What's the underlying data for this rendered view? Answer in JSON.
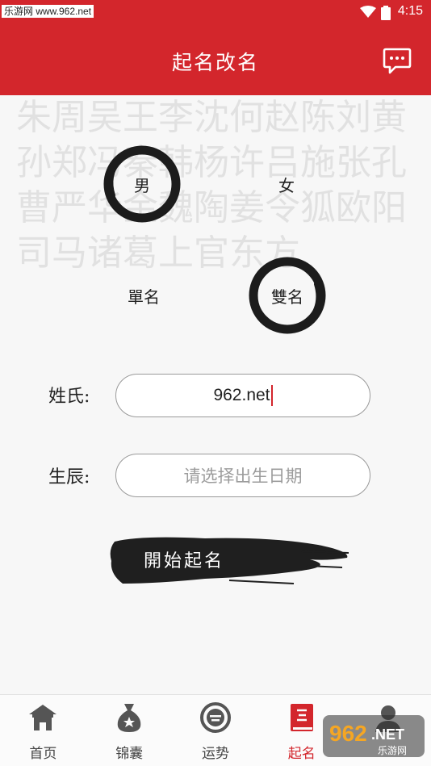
{
  "status_bar": {
    "watermark": "乐游网 www.962.net",
    "time": "4:15",
    "icons": [
      "wifi-icon",
      "battery-icon"
    ]
  },
  "app_bar": {
    "title": "起名改名",
    "message_icon": "chat-bubble-icon"
  },
  "background_chars": "朱周吴王李沈何赵陈刘黄孙郑冯秦韩杨许吕施张孔曹严华金魏陶姜令狐欧阳司马诸葛上官东方",
  "gender": {
    "options": [
      {
        "label": "男",
        "selected": true
      },
      {
        "label": "女",
        "selected": false
      }
    ]
  },
  "name_length": {
    "options": [
      {
        "label": "單名",
        "selected": false
      },
      {
        "label": "雙名",
        "selected": true
      }
    ]
  },
  "form": {
    "surname_label": "姓氏:",
    "surname_value": "962.net",
    "birth_label": "生辰:",
    "birth_placeholder": "请选择出生日期"
  },
  "start_button": "開始起名",
  "tabs": [
    {
      "label": "首页",
      "icon": "temple-home-icon",
      "active": false
    },
    {
      "label": "锦囊",
      "icon": "money-bag-icon",
      "active": false
    },
    {
      "label": "运势",
      "icon": "fortune-icon",
      "active": false
    },
    {
      "label": "起名",
      "icon": "name-book-icon",
      "active": true
    },
    {
      "label": "",
      "icon": "profile-icon",
      "active": false
    }
  ],
  "overlay_watermark": {
    "brand": "962",
    "suffix": ".NET",
    "sub": "乐游网"
  },
  "colors": {
    "brand_red": "#d3262c",
    "ink": "#222222"
  }
}
